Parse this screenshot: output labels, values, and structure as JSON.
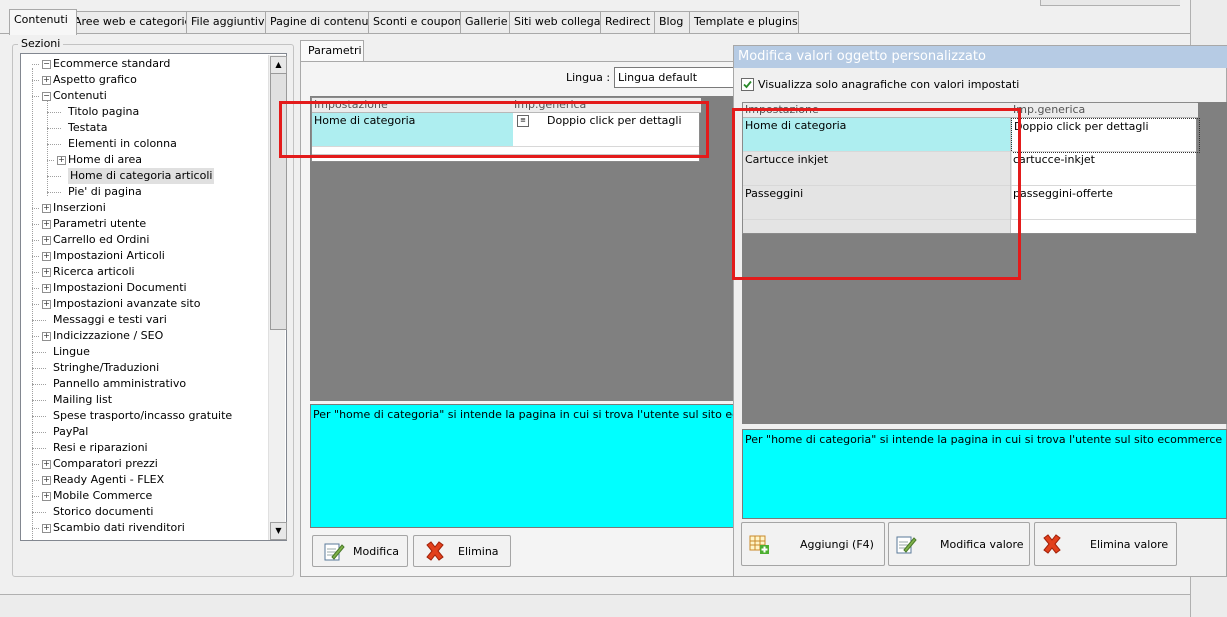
{
  "tabs": [
    "Contenuti",
    "Aree web e categorie",
    "File aggiuntivi",
    "Pagine di contenuti",
    "Sconti e coupon",
    "Gallerie",
    "Siti web collegati",
    "Redirect",
    "Blog",
    "Template e plugins"
  ],
  "sections": {
    "title": "Sezioni",
    "tree": [
      {
        "label": "Ecommerce standard",
        "expander": "−"
      },
      {
        "label": "Aspetto grafico",
        "expander": "+"
      },
      {
        "label": "Contenuti",
        "expander": "−"
      },
      {
        "label": "Titolo pagina"
      },
      {
        "label": "Testata"
      },
      {
        "label": "Elementi in colonna"
      },
      {
        "label": "Home di area",
        "expander": "+"
      },
      {
        "label": "Home di categoria articoli",
        "selected": true
      },
      {
        "label": "Pie' di pagina"
      },
      {
        "label": "Inserzioni",
        "expander": "+"
      },
      {
        "label": "Parametri utente",
        "expander": "+"
      },
      {
        "label": "Carrello ed Ordini",
        "expander": "+"
      },
      {
        "label": "Impostazioni Articoli",
        "expander": "+"
      },
      {
        "label": "Ricerca articoli",
        "expander": "+"
      },
      {
        "label": "Impostazioni Documenti",
        "expander": "+"
      },
      {
        "label": "Impostazioni avanzate sito",
        "expander": "+"
      },
      {
        "label": "Messaggi e testi vari"
      },
      {
        "label": "Indicizzazione / SEO",
        "expander": "+"
      },
      {
        "label": "Lingue"
      },
      {
        "label": "Stringhe/Traduzioni"
      },
      {
        "label": "Pannello amministrativo"
      },
      {
        "label": "Mailing list"
      },
      {
        "label": "Spese trasporto/incasso gratuite"
      },
      {
        "label": "PayPal"
      },
      {
        "label": "Resi e riparazioni"
      },
      {
        "label": "Comparatori prezzi",
        "expander": "+"
      },
      {
        "label": "Ready Agenti - FLEX",
        "expander": "+"
      },
      {
        "label": "Mobile Commerce",
        "expander": "+"
      },
      {
        "label": "Storico documenti"
      },
      {
        "label": "Scambio dati rivenditori",
        "expander": "+"
      }
    ]
  },
  "parametri": {
    "tab": "Parametri",
    "lingua_label": "Lingua :",
    "lingua_value": "Lingua default",
    "grid_headers": [
      "Impostazione",
      "Imp.generica"
    ],
    "row": {
      "setting": "Home di categoria",
      "value": "Doppio click per dettagli"
    },
    "description": "Per \"home di categoria\" si intende la pagina in cui si trova l'utente sul sito ecommerce qu",
    "buttons": {
      "modifica": "Modifica",
      "elimina": "Elimina"
    }
  },
  "dialog": {
    "title": "Modifica valori oggetto personalizzato",
    "checkbox_label": "Visualizza solo anagrafiche con valori impostati",
    "checkbox_checked": true,
    "grid_headers": [
      "Impostazione",
      "Imp.generica"
    ],
    "rows": [
      {
        "setting": "Home di categoria",
        "value": "Doppio click per dettagli"
      },
      {
        "setting": "Cartucce inkjet",
        "value": "cartucce-inkjet"
      },
      {
        "setting": "Passeggini",
        "value": "passeggini-offerte"
      }
    ],
    "description": "Per \"home di categoria\" si intende la pagina in cui si trova l'utente sul sito ecommerce quando clicca su",
    "buttons": {
      "add": "Aggiungi (F4)",
      "edit": "Modifica valore",
      "delete": "Elimina valore"
    }
  },
  "colors": {
    "highlight_cell": "#aeeef0",
    "description_bg": "#00ffff",
    "annotation_red": "#e31b1b",
    "grid_empty": "#808080"
  }
}
